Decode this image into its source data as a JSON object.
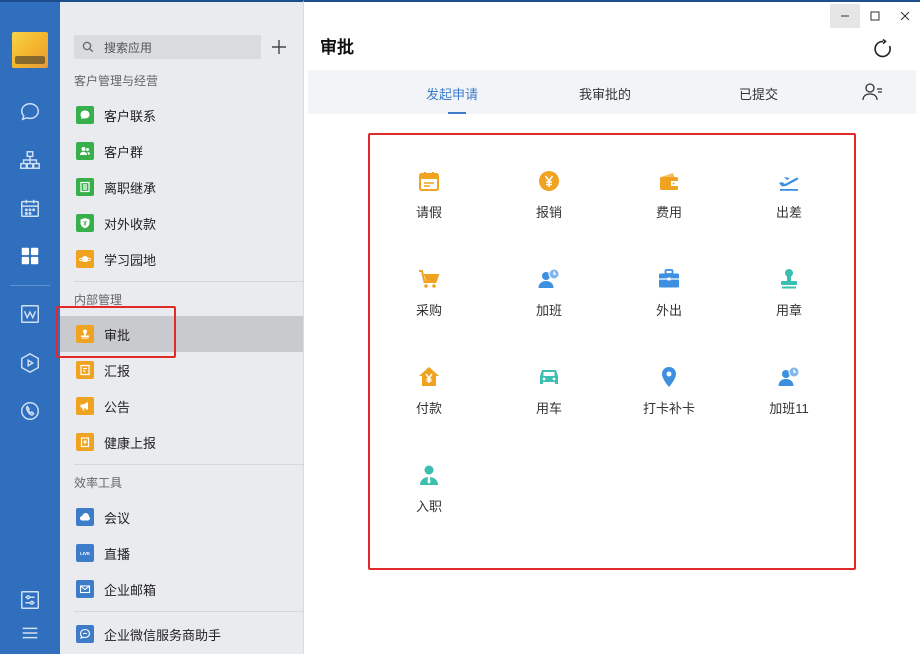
{
  "sidebar": {
    "search_placeholder": "搜索应用",
    "groups": [
      {
        "title": "客户管理与经营"
      },
      {
        "title": "内部管理"
      },
      {
        "title": "效率工具"
      }
    ],
    "items": [
      {
        "label": "客户联系",
        "color": "#37b04c",
        "icon": "chat-icon"
      },
      {
        "label": "客户群",
        "color": "#37b04c",
        "icon": "group-icon"
      },
      {
        "label": "离职继承",
        "color": "#37b04c",
        "icon": "list-icon"
      },
      {
        "label": "对外收款",
        "color": "#37b04c",
        "icon": "shield-yen-icon"
      },
      {
        "label": "学习园地",
        "color": "#f0a321",
        "icon": "planet-icon"
      },
      {
        "label": "审批",
        "color": "#f0a321",
        "icon": "stamp-icon"
      },
      {
        "label": "汇报",
        "color": "#f0a321",
        "icon": "report-icon"
      },
      {
        "label": "公告",
        "color": "#f0a321",
        "icon": "megaphone-icon"
      },
      {
        "label": "健康上报",
        "color": "#f0a321",
        "icon": "health-icon"
      },
      {
        "label": "会议",
        "color": "#3d7cc9",
        "icon": "cloud-icon"
      },
      {
        "label": "直播",
        "color": "#3d7cc9",
        "icon": "live-icon"
      },
      {
        "label": "企业邮箱",
        "color": "#3d7cc9",
        "icon": "mail-icon"
      },
      {
        "label": "企业微信服务商助手",
        "color": "#3d7cc9",
        "icon": "assistant-icon"
      }
    ],
    "active_item": "审批"
  },
  "main": {
    "title": "审批",
    "tabs": [
      {
        "label": "发起申请"
      },
      {
        "label": "我审批的"
      },
      {
        "label": "已提交"
      }
    ],
    "active_tab": "发起申请",
    "apps": [
      {
        "label": "请假",
        "icon": "calendar-icon",
        "color": "#f0a321"
      },
      {
        "label": "报销",
        "icon": "yen-coin-icon",
        "color": "#f0a321"
      },
      {
        "label": "费用",
        "icon": "wallet-icon",
        "color": "#f0a321"
      },
      {
        "label": "出差",
        "icon": "airplane-icon",
        "color": "#3d8fe0"
      },
      {
        "label": "采购",
        "icon": "cart-icon",
        "color": "#f0a321"
      },
      {
        "label": "加班",
        "icon": "user-clock-icon",
        "color": "#3d8fe0"
      },
      {
        "label": "外出",
        "icon": "briefcase-icon",
        "color": "#3d8fe0"
      },
      {
        "label": "用章",
        "icon": "stamp-icon",
        "color": "#3cbfae"
      },
      {
        "label": "付款",
        "icon": "house-yen-icon",
        "color": "#f0a321"
      },
      {
        "label": "用车",
        "icon": "car-icon",
        "color": "#3cbfae"
      },
      {
        "label": "打卡补卡",
        "icon": "location-pin-icon",
        "color": "#3d8fe0"
      },
      {
        "label": "加班11",
        "icon": "user-clock-icon",
        "color": "#3d8fe0"
      },
      {
        "label": "入职",
        "icon": "person-icon",
        "color": "#3cbfae"
      }
    ]
  },
  "colors": {
    "rail": "#2f6fbe",
    "accent": "#3d7cc9",
    "highlight": "#e02a2a"
  }
}
